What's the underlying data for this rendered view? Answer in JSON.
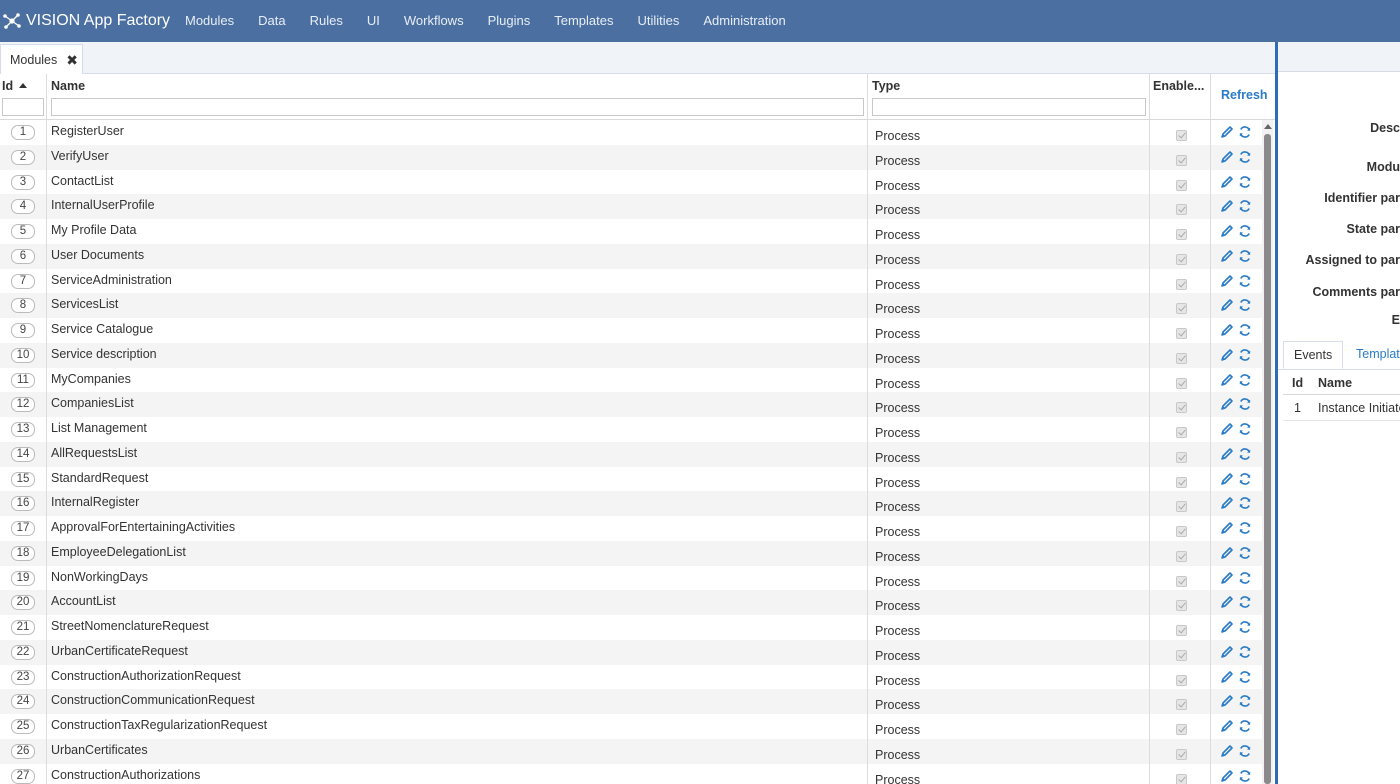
{
  "app": {
    "title": "VISION App Factory",
    "logo_icon": "network-nodes-icon"
  },
  "nav": {
    "items": [
      "Modules",
      "Data",
      "Rules",
      "UI",
      "Workflows",
      "Plugins",
      "Templates",
      "Utilities",
      "Administration"
    ]
  },
  "tabs": {
    "open": [
      {
        "label": "Modules",
        "close_icon": "close-x-icon"
      }
    ]
  },
  "grid": {
    "columns": {
      "id": "Id",
      "name": "Name",
      "type": "Type",
      "enabled": "Enable...",
      "refresh": "Refresh"
    },
    "sort": {
      "column": "Id",
      "direction": "ascending"
    },
    "rows": [
      {
        "id": "1",
        "name": "RegisterUser",
        "type": "Process",
        "enabled": true
      },
      {
        "id": "2",
        "name": "VerifyUser",
        "type": "Process",
        "enabled": true
      },
      {
        "id": "3",
        "name": "ContactList",
        "type": "Process",
        "enabled": true
      },
      {
        "id": "4",
        "name": "InternalUserProfile",
        "type": "Process",
        "enabled": true
      },
      {
        "id": "5",
        "name": "My Profile Data",
        "type": "Process",
        "enabled": true
      },
      {
        "id": "6",
        "name": "User Documents",
        "type": "Process",
        "enabled": true
      },
      {
        "id": "7",
        "name": "ServiceAdministration",
        "type": "Process",
        "enabled": true
      },
      {
        "id": "8",
        "name": "ServicesList",
        "type": "Process",
        "enabled": true
      },
      {
        "id": "9",
        "name": "Service Catalogue",
        "type": "Process",
        "enabled": true
      },
      {
        "id": "10",
        "name": "Service description",
        "type": "Process",
        "enabled": true
      },
      {
        "id": "11",
        "name": "MyCompanies",
        "type": "Process",
        "enabled": true
      },
      {
        "id": "12",
        "name": "CompaniesList",
        "type": "Process",
        "enabled": true
      },
      {
        "id": "13",
        "name": "List Management",
        "type": "Process",
        "enabled": true
      },
      {
        "id": "14",
        "name": "AllRequestsList",
        "type": "Process",
        "enabled": true
      },
      {
        "id": "15",
        "name": "StandardRequest",
        "type": "Process",
        "enabled": true
      },
      {
        "id": "16",
        "name": "InternalRegister",
        "type": "Process",
        "enabled": true
      },
      {
        "id": "17",
        "name": "ApprovalForEntertainingActivities",
        "type": "Process",
        "enabled": true
      },
      {
        "id": "18",
        "name": "EmployeeDelegationList",
        "type": "Process",
        "enabled": true
      },
      {
        "id": "19",
        "name": "NonWorkingDays",
        "type": "Process",
        "enabled": true
      },
      {
        "id": "20",
        "name": "AccountList",
        "type": "Process",
        "enabled": true
      },
      {
        "id": "21",
        "name": "StreetNomenclatureRequest",
        "type": "Process",
        "enabled": true
      },
      {
        "id": "22",
        "name": "UrbanCertificateRequest",
        "type": "Process",
        "enabled": true
      },
      {
        "id": "23",
        "name": "ConstructionAuthorizationRequest",
        "type": "Process",
        "enabled": true
      },
      {
        "id": "24",
        "name": "ConstructionCommunicationRequest",
        "type": "Process",
        "enabled": true
      },
      {
        "id": "25",
        "name": "ConstructionTaxRegularizationRequest",
        "type": "Process",
        "enabled": true
      },
      {
        "id": "26",
        "name": "UrbanCertificates",
        "type": "Process",
        "enabled": true
      },
      {
        "id": "27",
        "name": "ConstructionAuthorizations",
        "type": "Process",
        "enabled": true
      }
    ],
    "row_action_icons": [
      "edit-pencil-icon",
      "sync-refresh-icon"
    ]
  },
  "detail": {
    "field_labels": [
      "Desc",
      "Modu",
      "Identifier par",
      "State par",
      "Assigned to par",
      "Comments par",
      "E"
    ],
    "tabs": [
      "Events",
      "Templat"
    ],
    "events_table": {
      "headers": {
        "id": "Id",
        "name": "Name"
      },
      "rows": [
        {
          "id": "1",
          "name": "Instance Initiate"
        }
      ]
    }
  },
  "colors": {
    "nav_background": "#4a6fa0",
    "accent_link": "#2a7cc7",
    "splitter": "#2d6db5"
  }
}
